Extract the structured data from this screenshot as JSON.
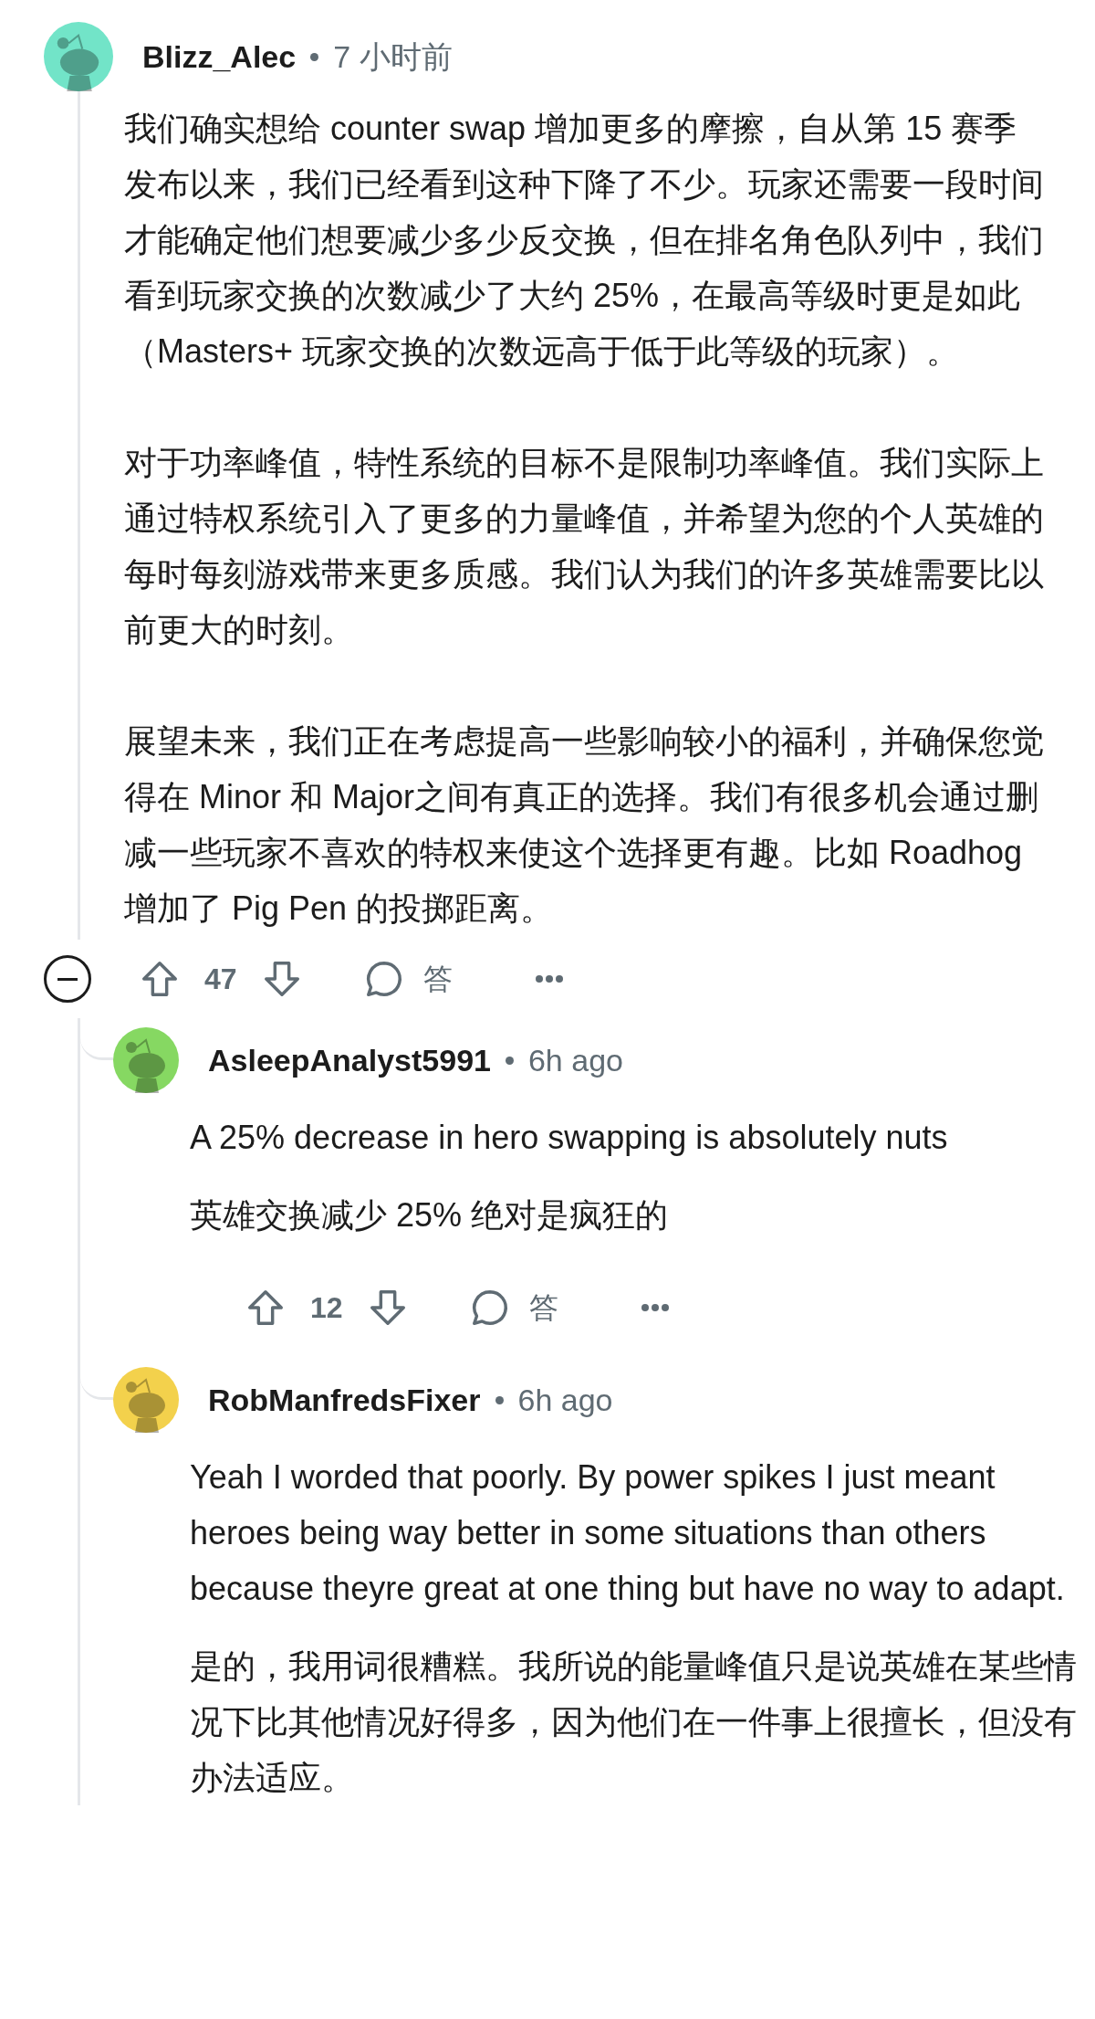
{
  "comment": {
    "author": "Blizz_Alec",
    "time": "7 小时前",
    "expanded": true,
    "paragraphs": [
      "我们确实想给 counter swap 增加更多的摩擦，自从第 15 赛季发布以来，我们已经看到这种下降了不少。玩家还需要一段时间才能确定他们想要减少多少反交换，但在排名角色队列中，我们看到玩家交换的次数减少了大约 25%，在最高等级时更是如此（Masters+ 玩家交换的次数远高于低于此等级的玩家）。",
      "对于功率峰值，特性系统的目标不是限制功率峰值。我们实际上通过特权系统引入了更多的力量峰值，并希望为您的个人英雄的每时每刻游戏带来更多质感。我们认为我们的许多英雄需要比以前更大的时刻。",
      "展望未来，我们正在考虑提高一些影响较小的福利，并确保您觉得在 Minor 和 Major之间有真正的选择。我们有很多机会通过删减一些玩家不喜欢的特权来使这个选择更有趣。比如 Roadhog 增加了 Pig Pen 的投掷距离。"
    ],
    "votes": "47",
    "reply_label": "答",
    "children": [
      {
        "author": "AsleepAnalyst5991",
        "time": "6h ago",
        "paragraphs": [
          "A 25% decrease in hero swapping is absolutely nuts",
          "英雄交换减少 25% 绝对是疯狂的"
        ],
        "votes": "12",
        "reply_label": "答"
      },
      {
        "author": "RobManfredsFixer",
        "time": "6h ago",
        "paragraphs": [
          "Yeah I worded that poorly. By power spikes I just meant heroes being way better in some situations than others because theyre great at one thing but have no way to adapt.",
          "是的，我用词很糟糕。我所说的能量峰值只是说英雄在某些情况下比其他情况好得多，因为他们在一件事上很擅长，但没有办法适应。"
        ]
      }
    ]
  }
}
